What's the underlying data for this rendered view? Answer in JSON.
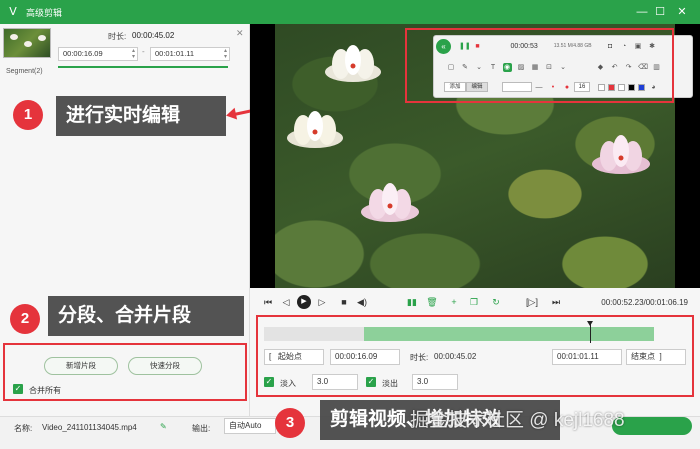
{
  "titlebar": {
    "title": "高级剪辑",
    "minimize": "—",
    "maximize": "☐",
    "close": "✕"
  },
  "segment": {
    "label": "Segment(2)",
    "duration_label": "时长:",
    "duration_value": "00:00:45.02",
    "start_time": "00:00:16.09",
    "end_time": "00:01:01.11"
  },
  "buttons": {
    "new_segment": "新增片段",
    "quick_split": "快速分段",
    "merge_all": "合并所有"
  },
  "callouts": {
    "c1": {
      "num": "1",
      "text": "进行实时编辑"
    },
    "c2": {
      "num": "2",
      "text": "分段、合并片段"
    },
    "c3": {
      "num": "3",
      "text": "剪辑视频、增加特效"
    }
  },
  "overlay_toolbar": {
    "timer": "00:00:53",
    "size": "13.51 M/4.88 GB",
    "mode_a": "添加",
    "mode_b": "编辑",
    "number": "16"
  },
  "playback": {
    "time_readout": "00:00:52.23/00:01:06.19"
  },
  "edit": {
    "start_btn": "起始点",
    "start_value": "00:00:16.09",
    "duration_label": "时长:",
    "duration_value": "00:00:45.02",
    "end_value": "00:01:01.11",
    "end_btn": "结束点",
    "fade_in_label": "淡入",
    "fade_in_value": "3.0",
    "fade_out_label": "淡出",
    "fade_out_value": "3.0"
  },
  "bottom": {
    "name_label": "名称:",
    "filename": "Video_241101134045.mp4",
    "output_label": "输出:",
    "output_value": "自动Auto"
  },
  "watermark": "掘金技术社区 @ kejl1688",
  "colors": {
    "brand_green": "#2aa24a",
    "callout_red": "#e5343c"
  }
}
